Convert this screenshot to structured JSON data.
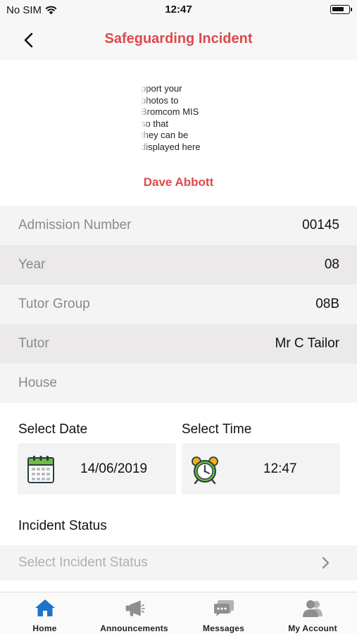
{
  "status_bar": {
    "carrier": "No SIM",
    "time": "12:47"
  },
  "header": {
    "title": "Safeguarding Incident"
  },
  "photo": {
    "placeholder_lines": [
      "pport your",
      "photos to",
      "Bromcom MIS",
      "so that",
      "they can be",
      "displayed here"
    ],
    "student_name": "Dave Abbott"
  },
  "student_info": [
    {
      "label": "Admission Number",
      "value": "00145"
    },
    {
      "label": "Year",
      "value": "08"
    },
    {
      "label": "Tutor Group",
      "value": "08B"
    },
    {
      "label": "Tutor",
      "value": "Mr C Tailor"
    },
    {
      "label": "House",
      "value": ""
    }
  ],
  "date_picker": {
    "label": "Select Date",
    "value": "14/06/2019",
    "icon": "calendar-icon"
  },
  "time_picker": {
    "label": "Select Time",
    "value": "12:47",
    "icon": "alarm-clock-icon"
  },
  "incident_status": {
    "label": "Incident Status",
    "placeholder": "Select Incident Status"
  },
  "tab_bar": {
    "tabs": [
      {
        "label": "Home",
        "icon": "home-icon",
        "active": true
      },
      {
        "label": "Announcements",
        "icon": "megaphone-icon"
      },
      {
        "label": "Messages",
        "icon": "messages-icon"
      },
      {
        "label": "My Account",
        "icon": "account-icon"
      }
    ],
    "active_color": "#1f74c8",
    "inactive_color": "#8e8e8e"
  },
  "colors": {
    "accent": "#e0474c"
  }
}
